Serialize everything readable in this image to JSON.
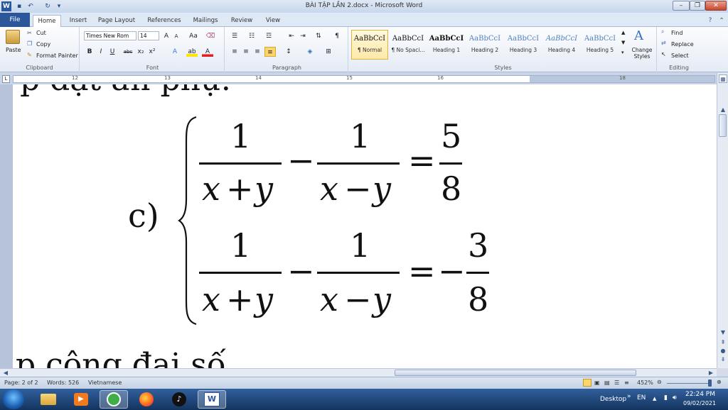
{
  "window": {
    "title": "BÀI TẬP LẦN 2.docx - Microsoft Word",
    "app_letter": "W"
  },
  "tabs": [
    "File",
    "Home",
    "Insert",
    "Page Layout",
    "References",
    "Mailings",
    "Review",
    "View"
  ],
  "clipboard": {
    "paste": "Paste",
    "cut": "Cut",
    "copy": "Copy",
    "format_painter": "Format Painter",
    "label": "Clipboard"
  },
  "font": {
    "name": "Times New Rom",
    "size": "14",
    "label": "Font"
  },
  "paragraph": {
    "label": "Paragraph"
  },
  "styles": {
    "label": "Styles",
    "items": [
      {
        "sample": "AaBbCcI",
        "name": "¶ Normal"
      },
      {
        "sample": "AaBbCcI",
        "name": "¶ No Spaci..."
      },
      {
        "sample": "AaBbCcI",
        "name": "Heading 1"
      },
      {
        "sample": "AaBbCcI",
        "name": "Heading 2"
      },
      {
        "sample": "AaBbCcI",
        "name": "Heading 3"
      },
      {
        "sample": "AaBbCcI",
        "name": "Heading 4"
      },
      {
        "sample": "AaBbCcI",
        "name": "Heading 5"
      }
    ],
    "change_styles": "Change Styles"
  },
  "editing": {
    "find": "Find",
    "replace": "Replace",
    "select": "Select",
    "label": "Editing"
  },
  "ruler": {
    "numbers": [
      "12",
      "13",
      "14",
      "15",
      "16",
      "18"
    ]
  },
  "document": {
    "top_text": "p đặt ẩn phụ:",
    "item_label": "c)",
    "one": "1",
    "x_plus_y_x": "x",
    "plus": "+",
    "minus_op": "−",
    "y": "y",
    "eq": "=",
    "num_5": "5",
    "den_8": "8",
    "num_3": "3",
    "bottom_text": "p cộng đại số"
  },
  "status": {
    "page": "Page: 2 of 2",
    "words": "Words: 526",
    "language": "Vietnamese",
    "zoom": "452%"
  },
  "taskbar": {
    "desktop": "Desktop",
    "lang": "EN",
    "time": "22:24 PM",
    "date": "09/02/2021"
  },
  "colors": {
    "file_tab": "#2b579a",
    "taskbar": "#1f467c"
  }
}
